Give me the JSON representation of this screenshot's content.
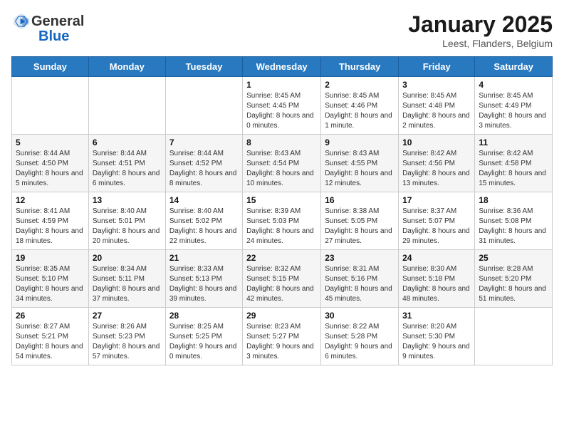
{
  "header": {
    "logo_general": "General",
    "logo_blue": "Blue",
    "month": "January 2025",
    "location": "Leest, Flanders, Belgium"
  },
  "weekdays": [
    "Sunday",
    "Monday",
    "Tuesday",
    "Wednesday",
    "Thursday",
    "Friday",
    "Saturday"
  ],
  "weeks": [
    [
      {
        "day": "",
        "info": ""
      },
      {
        "day": "",
        "info": ""
      },
      {
        "day": "",
        "info": ""
      },
      {
        "day": "1",
        "info": "Sunrise: 8:45 AM\nSunset: 4:45 PM\nDaylight: 8 hours and 0 minutes."
      },
      {
        "day": "2",
        "info": "Sunrise: 8:45 AM\nSunset: 4:46 PM\nDaylight: 8 hours and 1 minute."
      },
      {
        "day": "3",
        "info": "Sunrise: 8:45 AM\nSunset: 4:48 PM\nDaylight: 8 hours and 2 minutes."
      },
      {
        "day": "4",
        "info": "Sunrise: 8:45 AM\nSunset: 4:49 PM\nDaylight: 8 hours and 3 minutes."
      }
    ],
    [
      {
        "day": "5",
        "info": "Sunrise: 8:44 AM\nSunset: 4:50 PM\nDaylight: 8 hours and 5 minutes."
      },
      {
        "day": "6",
        "info": "Sunrise: 8:44 AM\nSunset: 4:51 PM\nDaylight: 8 hours and 6 minutes."
      },
      {
        "day": "7",
        "info": "Sunrise: 8:44 AM\nSunset: 4:52 PM\nDaylight: 8 hours and 8 minutes."
      },
      {
        "day": "8",
        "info": "Sunrise: 8:43 AM\nSunset: 4:54 PM\nDaylight: 8 hours and 10 minutes."
      },
      {
        "day": "9",
        "info": "Sunrise: 8:43 AM\nSunset: 4:55 PM\nDaylight: 8 hours and 12 minutes."
      },
      {
        "day": "10",
        "info": "Sunrise: 8:42 AM\nSunset: 4:56 PM\nDaylight: 8 hours and 13 minutes."
      },
      {
        "day": "11",
        "info": "Sunrise: 8:42 AM\nSunset: 4:58 PM\nDaylight: 8 hours and 15 minutes."
      }
    ],
    [
      {
        "day": "12",
        "info": "Sunrise: 8:41 AM\nSunset: 4:59 PM\nDaylight: 8 hours and 18 minutes."
      },
      {
        "day": "13",
        "info": "Sunrise: 8:40 AM\nSunset: 5:01 PM\nDaylight: 8 hours and 20 minutes."
      },
      {
        "day": "14",
        "info": "Sunrise: 8:40 AM\nSunset: 5:02 PM\nDaylight: 8 hours and 22 minutes."
      },
      {
        "day": "15",
        "info": "Sunrise: 8:39 AM\nSunset: 5:03 PM\nDaylight: 8 hours and 24 minutes."
      },
      {
        "day": "16",
        "info": "Sunrise: 8:38 AM\nSunset: 5:05 PM\nDaylight: 8 hours and 27 minutes."
      },
      {
        "day": "17",
        "info": "Sunrise: 8:37 AM\nSunset: 5:07 PM\nDaylight: 8 hours and 29 minutes."
      },
      {
        "day": "18",
        "info": "Sunrise: 8:36 AM\nSunset: 5:08 PM\nDaylight: 8 hours and 31 minutes."
      }
    ],
    [
      {
        "day": "19",
        "info": "Sunrise: 8:35 AM\nSunset: 5:10 PM\nDaylight: 8 hours and 34 minutes."
      },
      {
        "day": "20",
        "info": "Sunrise: 8:34 AM\nSunset: 5:11 PM\nDaylight: 8 hours and 37 minutes."
      },
      {
        "day": "21",
        "info": "Sunrise: 8:33 AM\nSunset: 5:13 PM\nDaylight: 8 hours and 39 minutes."
      },
      {
        "day": "22",
        "info": "Sunrise: 8:32 AM\nSunset: 5:15 PM\nDaylight: 8 hours and 42 minutes."
      },
      {
        "day": "23",
        "info": "Sunrise: 8:31 AM\nSunset: 5:16 PM\nDaylight: 8 hours and 45 minutes."
      },
      {
        "day": "24",
        "info": "Sunrise: 8:30 AM\nSunset: 5:18 PM\nDaylight: 8 hours and 48 minutes."
      },
      {
        "day": "25",
        "info": "Sunrise: 8:28 AM\nSunset: 5:20 PM\nDaylight: 8 hours and 51 minutes."
      }
    ],
    [
      {
        "day": "26",
        "info": "Sunrise: 8:27 AM\nSunset: 5:21 PM\nDaylight: 8 hours and 54 minutes."
      },
      {
        "day": "27",
        "info": "Sunrise: 8:26 AM\nSunset: 5:23 PM\nDaylight: 8 hours and 57 minutes."
      },
      {
        "day": "28",
        "info": "Sunrise: 8:25 AM\nSunset: 5:25 PM\nDaylight: 9 hours and 0 minutes."
      },
      {
        "day": "29",
        "info": "Sunrise: 8:23 AM\nSunset: 5:27 PM\nDaylight: 9 hours and 3 minutes."
      },
      {
        "day": "30",
        "info": "Sunrise: 8:22 AM\nSunset: 5:28 PM\nDaylight: 9 hours and 6 minutes."
      },
      {
        "day": "31",
        "info": "Sunrise: 8:20 AM\nSunset: 5:30 PM\nDaylight: 9 hours and 9 minutes."
      },
      {
        "day": "",
        "info": ""
      }
    ]
  ]
}
